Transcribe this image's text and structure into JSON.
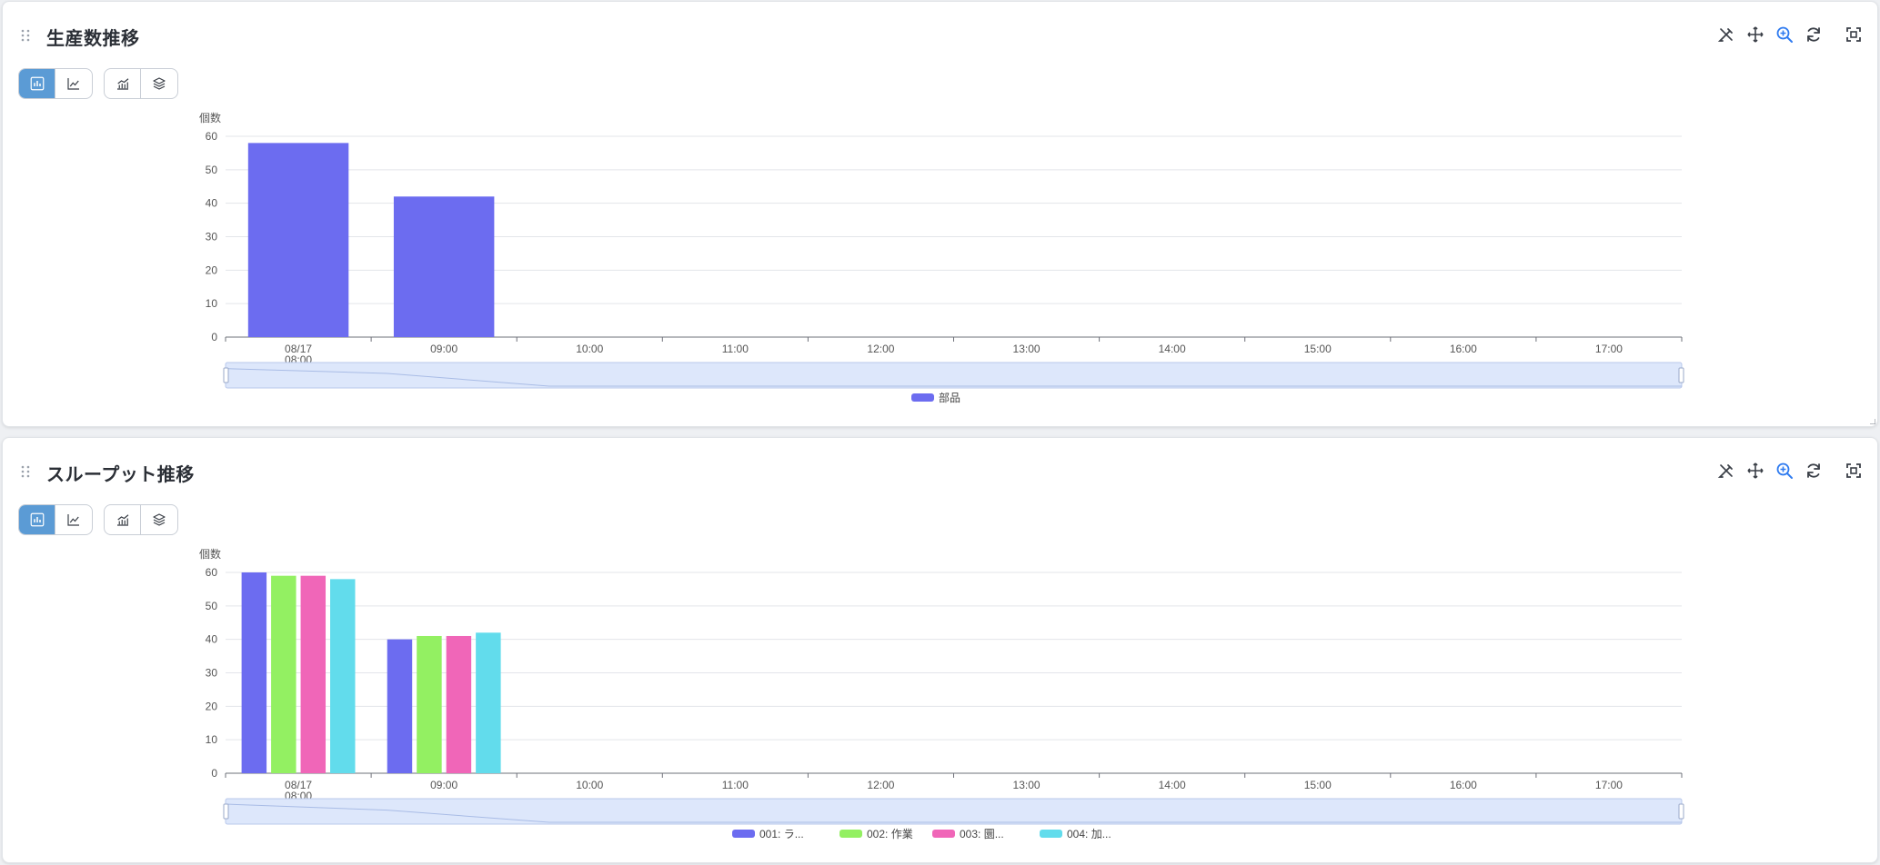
{
  "charts": [
    {
      "panel": "panel1",
      "title": "生産数推移",
      "view_toggle": {
        "active": "bar",
        "options": [
          "bar-chart-icon",
          "line-chart-icon"
        ]
      },
      "extra_toggle": [
        "combo-chart-icon",
        "layers-icon"
      ],
      "toolbar": [
        "draw-icon",
        "pan-icon",
        "zoom-icon",
        "refresh-icon",
        "fullscreen-icon"
      ],
      "chart_data": {
        "type": "bar",
        "ylabel": "個数",
        "ylim": [
          0,
          60
        ],
        "yticks": [
          0,
          10,
          20,
          30,
          40,
          50,
          60
        ],
        "categories": [
          "08/17\n08:00",
          "09:00",
          "10:00",
          "11:00",
          "12:00",
          "13:00",
          "14:00",
          "15:00",
          "16:00",
          "17:00"
        ],
        "series": [
          {
            "name": "部品",
            "color": "#6c6cf0",
            "values": [
              58,
              42,
              0,
              0,
              0,
              0,
              0,
              0,
              0,
              0
            ]
          }
        ],
        "legend": "bottom-center",
        "grid": true,
        "datazoom_slider": true
      }
    },
    {
      "panel": "panel2",
      "title": "スループット推移",
      "view_toggle": {
        "active": "bar",
        "options": [
          "bar-chart-icon",
          "line-chart-icon"
        ]
      },
      "extra_toggle": [
        "combo-chart-icon",
        "layers-icon"
      ],
      "toolbar": [
        "draw-icon",
        "pan-icon",
        "zoom-icon",
        "refresh-icon",
        "fullscreen-icon"
      ],
      "chart_data": {
        "type": "bar",
        "ylabel": "個数",
        "ylim": [
          0,
          60
        ],
        "yticks": [
          0,
          10,
          20,
          30,
          40,
          50,
          60
        ],
        "categories": [
          "08/17\n08:00",
          "09:00",
          "10:00",
          "11:00",
          "12:00",
          "13:00",
          "14:00",
          "15:00",
          "16:00",
          "17:00"
        ],
        "series": [
          {
            "name": "001: ラ...",
            "color": "#6c6cf0",
            "values": [
              60,
              40,
              0,
              0,
              0,
              0,
              0,
              0,
              0,
              0
            ]
          },
          {
            "name": "002: 作業",
            "color": "#93f062",
            "values": [
              59,
              41,
              0,
              0,
              0,
              0,
              0,
              0,
              0,
              0
            ]
          },
          {
            "name": "003: 圜...",
            "color": "#f066b8",
            "values": [
              59,
              41,
              0,
              0,
              0,
              0,
              0,
              0,
              0,
              0
            ]
          },
          {
            "name": "004: 加...",
            "color": "#62dcec",
            "values": [
              58,
              42,
              0,
              0,
              0,
              0,
              0,
              0,
              0,
              0
            ]
          }
        ],
        "legend": "bottom-center",
        "grid": true,
        "datazoom_slider": true
      }
    }
  ]
}
